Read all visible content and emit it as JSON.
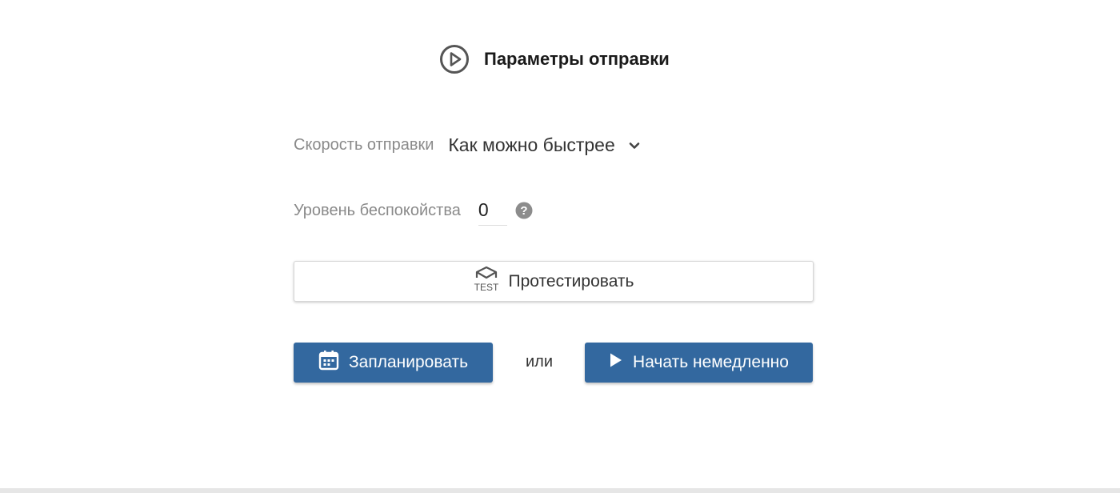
{
  "header": {
    "title": "Параметры отправки",
    "icon": "play-circle-icon"
  },
  "speed": {
    "label": "Скорость отправки",
    "selected": "Как можно быстрее",
    "icon": "chevron-down-icon"
  },
  "level": {
    "label": "Уровень беспокойства",
    "value": "0",
    "help_icon": "question-circle-icon"
  },
  "test_button": {
    "label": "Протестировать",
    "icon": "test-envelope-icon",
    "icon_text": "TEST"
  },
  "actions": {
    "schedule_label": "Запланировать",
    "schedule_icon": "calendar-icon",
    "separator": "или",
    "start_label": "Начать немедленно",
    "start_icon": "play-icon"
  },
  "colors": {
    "primary": "#33689f",
    "label_gray": "#8a8a8a",
    "text_dark": "#333333"
  }
}
